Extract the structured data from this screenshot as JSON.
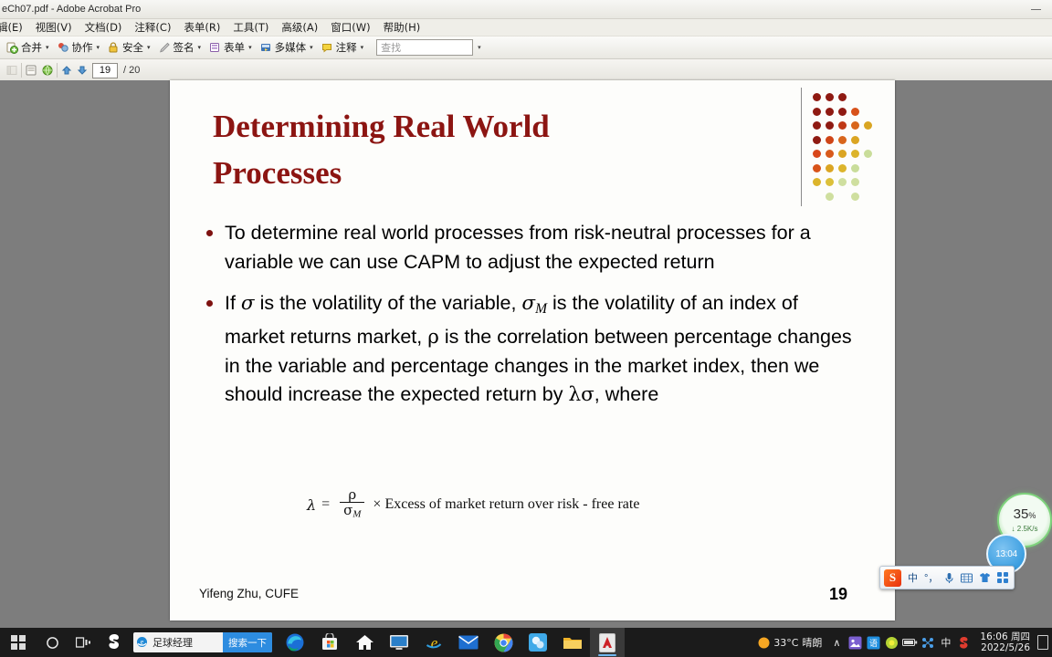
{
  "window": {
    "title": "eCh07.pdf - Adobe Acrobat Pro",
    "minimize_label": "–"
  },
  "menubar": {
    "items": [
      {
        "label": "辑(E)"
      },
      {
        "label": "视图(V)"
      },
      {
        "label": "文档(D)"
      },
      {
        "label": "注释(C)"
      },
      {
        "label": "表单(R)"
      },
      {
        "label": "工具(T)"
      },
      {
        "label": "高级(A)"
      },
      {
        "label": "窗口(W)"
      },
      {
        "label": "帮助(H)"
      }
    ]
  },
  "toolbar": {
    "buttons": [
      {
        "label": "合并",
        "icon": "merge-icon"
      },
      {
        "label": "协作",
        "icon": "collaborate-icon"
      },
      {
        "label": "安全",
        "icon": "lock-icon"
      },
      {
        "label": "签名",
        "icon": "pen-icon"
      },
      {
        "label": "表单",
        "icon": "form-icon"
      },
      {
        "label": "多媒体",
        "icon": "multimedia-icon"
      },
      {
        "label": "注释",
        "icon": "comment-icon"
      }
    ],
    "caret": "▾",
    "find_placeholder": "查找"
  },
  "pagebar": {
    "current_page": "19",
    "total_pages": "/ 20"
  },
  "slide": {
    "title": "Determining Real World Processes",
    "bullets": [
      {
        "segments": [
          {
            "t": "text",
            "v": "To determine real world processes from risk-neutral processes for a variable we can use CAPM to adjust the expected return"
          }
        ]
      },
      {
        "segments": [
          {
            "t": "text",
            "v": "If "
          },
          {
            "t": "greek-italic",
            "v": "σ"
          },
          {
            "t": "text",
            "v": " is the volatility of the variable, "
          },
          {
            "t": "greek-italic",
            "v": "σ"
          },
          {
            "t": "sub",
            "v": "M"
          },
          {
            "t": "text",
            "v": " is the volatility of an index of market returns market, "
          },
          {
            "t": "greek",
            "v": "ρ"
          },
          {
            "t": "text",
            "v": " is the correlation between percentage changes in the variable and percentage changes in the market index, then we should increase the expected return by "
          },
          {
            "t": "greek",
            "v": "λσ"
          },
          {
            "t": "text",
            "v": ", where"
          }
        ]
      }
    ],
    "formula": {
      "lhs": "λ",
      "equals": "=",
      "numerator": "ρ",
      "denominator_base": "σ",
      "denominator_sub": "M",
      "times": "×",
      "rhs": "Excess of market return over risk - free rate"
    },
    "footer_author": "Yifeng Zhu, CUFE",
    "footer_page": "19",
    "colors": {
      "title": "#8c1512",
      "bullet_dot": "#7e1210"
    },
    "dot_grid": {
      "rows": [
        [
          "#8f1a12",
          "#8f1a12",
          "#8f1a12",
          "",
          ""
        ],
        [
          "#8f1a12",
          "#8f1a12",
          "#8f1a12",
          "#d8521a",
          ""
        ],
        [
          "#8f1a12",
          "#8f1a12",
          "#bf3816",
          "#d8651c",
          "#d9a522"
        ],
        [
          "#8f1a12",
          "#cf4517",
          "#d8651c",
          "#dba522",
          ""
        ],
        [
          "#d8471a",
          "#d85a1b",
          "#dba522",
          "#dcb42b",
          "#c9dd9a"
        ],
        [
          "#d8531a",
          "#dba522",
          "#dcb42b",
          "#c9dd9a",
          ""
        ],
        [
          "#dcb42b",
          "#dcc03a",
          "#cfdf9f",
          "#cfdf9f",
          ""
        ],
        [
          "",
          "#cfdf9f",
          "",
          "#cfdf9f",
          ""
        ]
      ]
    }
  },
  "widgets": {
    "network": {
      "percent": "35",
      "percent_symbol": "%",
      "speed": "↓ 2.5K/s"
    },
    "clock_bubble": {
      "time": "13:04"
    }
  },
  "ime": {
    "logo": "S",
    "items": [
      {
        "label": "中",
        "name": "chinese-mode-icon"
      },
      {
        "label": "°，",
        "name": "punctuation-icon"
      },
      {
        "label": "🎙",
        "name": "microphone-icon"
      },
      {
        "label": "⌨",
        "name": "keyboard-icon"
      },
      {
        "label": "👕",
        "name": "skin-icon"
      },
      {
        "label": "☶",
        "name": "apps-icon"
      }
    ]
  },
  "taskbar": {
    "search": {
      "query": "足球经理",
      "button_label": "搜索一下"
    },
    "apps": [
      {
        "name": "edge-icon"
      },
      {
        "name": "store-icon"
      },
      {
        "name": "home-icon"
      },
      {
        "name": "display-icon"
      },
      {
        "name": "internet-explorer-icon"
      },
      {
        "name": "mail-icon"
      },
      {
        "name": "chrome-icon"
      },
      {
        "name": "wechat-icon"
      },
      {
        "name": "explorer-icon"
      },
      {
        "name": "acrobat-icon"
      }
    ],
    "tray": {
      "weather_temp": "33°C",
      "weather_desc": "晴朗",
      "chevron": "∧",
      "ime_label": "中",
      "time": "16:06 周四",
      "date": "2022/5/26"
    }
  }
}
